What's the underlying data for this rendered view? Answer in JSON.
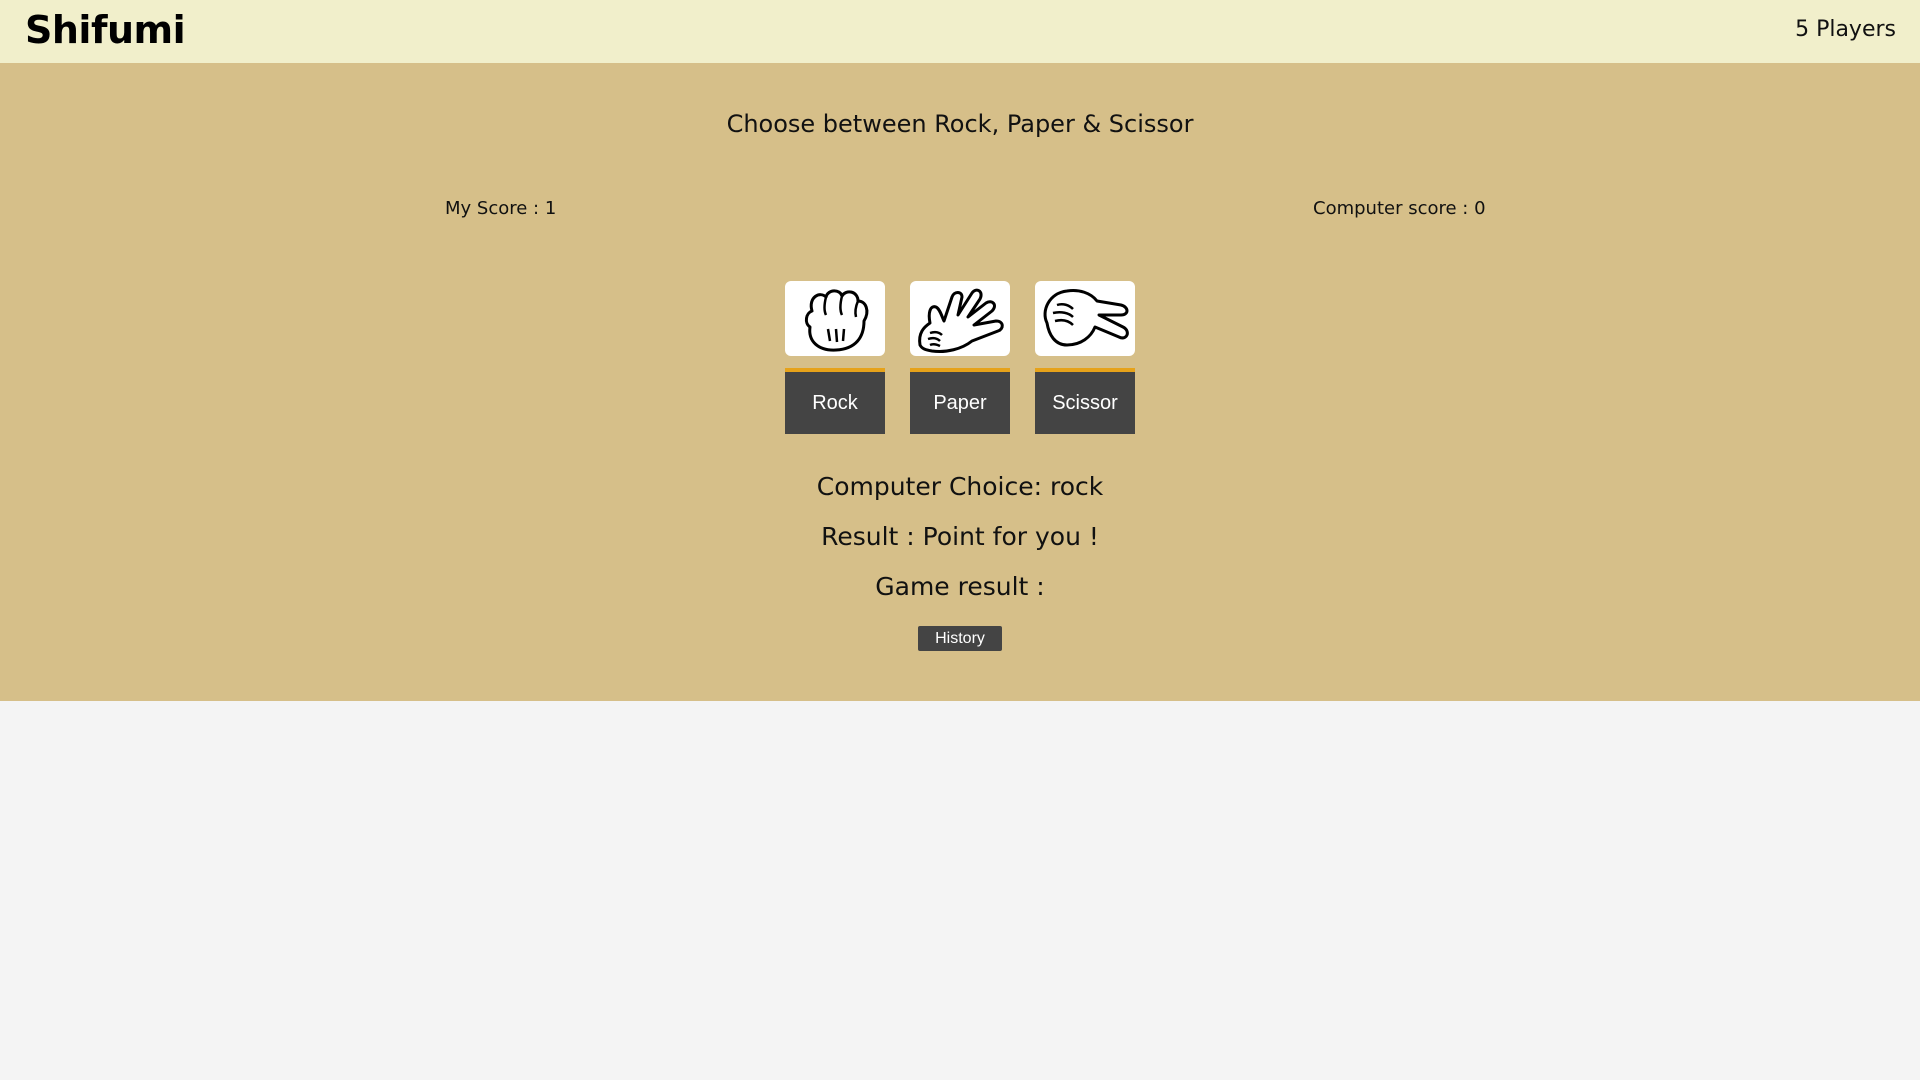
{
  "header": {
    "brand": "Shifumi",
    "players": "5 Players"
  },
  "game": {
    "prompt": "Choose between Rock, Paper & Scissor",
    "my_score": "My Score : 1",
    "computer_score": "Computer score : 0",
    "choices": [
      {
        "label": "Rock",
        "icon": "rock-hand-icon"
      },
      {
        "label": "Paper",
        "icon": "paper-hand-icon"
      },
      {
        "label": "Scissor",
        "icon": "scissor-hand-icon"
      }
    ],
    "computer_choice": "Computer Choice: rock",
    "result": "Result : Point for you !",
    "game_result": "Game result :",
    "history_label": "History"
  },
  "colors": {
    "header_bg": "#f1efcb",
    "game_bg": "#d6bf89",
    "page_bg": "#f4f4f4",
    "button_bg": "#444444",
    "button_accent": "#e6a21a"
  }
}
